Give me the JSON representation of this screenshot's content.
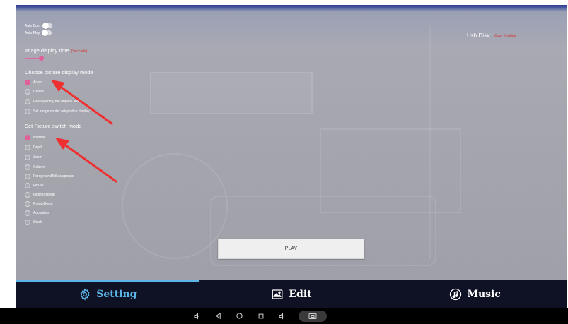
{
  "toggles": [
    {
      "label": "Auto Boot",
      "on": false
    },
    {
      "label": "Auto Play",
      "on": false
    }
  ],
  "usb": {
    "label": "Usb Disk:",
    "status": "Copy finished"
  },
  "display_time": {
    "label": "Image display time",
    "unit": "(Seconds)",
    "slider_fraction": 0.03
  },
  "picture_mode": {
    "title": "Choose picture display mode",
    "options": [
      "Adapt",
      "Center",
      "Reshaped by the original size",
      "Set image center adaptation display"
    ],
    "selected": "Adapt"
  },
  "switch_mode": {
    "title": "Set Picture switch mode",
    "options": [
      "Normal",
      "Depth",
      "Zoom",
      "CubeIn",
      "ForegroundToBackground",
      "Flip3D",
      "FlipHorizontal",
      "RotateDown",
      "Accordion",
      "Stack"
    ],
    "selected": "Normal"
  },
  "play_button": {
    "label": "PLAY"
  },
  "tabs": [
    {
      "label": "Setting",
      "icon": "gear-icon",
      "active": true
    },
    {
      "label": "Edit",
      "icon": "image-icon",
      "active": false
    },
    {
      "label": "Music",
      "icon": "music-note-icon",
      "active": false
    }
  ],
  "system_nav": [
    "volume-down-icon",
    "back-icon",
    "home-icon",
    "recents-icon",
    "volume-up-icon",
    "screenshot-icon"
  ],
  "colors": {
    "accent_pink": "#e0609a",
    "tab_active": "#5bb5e6",
    "status_red": "#d83030"
  }
}
